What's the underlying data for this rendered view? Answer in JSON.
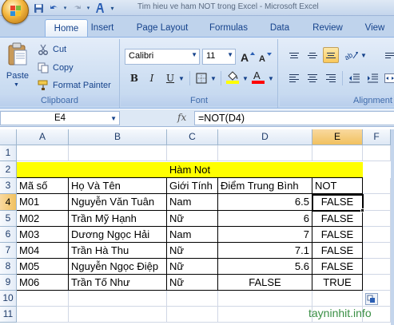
{
  "window": {
    "title": "Tim hieu ve ham NOT trong Excel - Microsoft Excel"
  },
  "tabs": [
    "Home",
    "Insert",
    "Page Layout",
    "Formulas",
    "Data",
    "Review",
    "View"
  ],
  "clipboard": {
    "paste_label": "Paste",
    "cut_label": "Cut",
    "copy_label": "Copy",
    "format_painter_label": "Format Painter",
    "group_label": "Clipboard"
  },
  "font": {
    "name": "Calibri",
    "size": "11",
    "group_label": "Font",
    "fill_color": "#ffff00",
    "font_color": "#ff0000"
  },
  "alignment": {
    "group_label": "Alignment"
  },
  "formula_bar": {
    "name_box": "E4",
    "fx": "fx",
    "formula": "=NOT(D4)"
  },
  "columns": [
    "A",
    "B",
    "C",
    "D",
    "E",
    "F"
  ],
  "rows": [
    "1",
    "2",
    "3",
    "4",
    "5",
    "6",
    "7",
    "8",
    "9",
    "10",
    "11"
  ],
  "sheet": {
    "title": "Hàm Not",
    "headers": [
      "Mã số",
      "Họ Và Tên",
      "Giới Tính",
      "Điểm Trung Bình",
      "NOT"
    ],
    "data": [
      [
        "M01",
        "Nguyễn Văn Tuân",
        "Nam",
        "6.5",
        "FALSE"
      ],
      [
        "M02",
        "Trần Mỹ Hạnh",
        "Nữ",
        "6",
        "FALSE"
      ],
      [
        "M03",
        "Dương Ngọc Hải",
        "Nam",
        "7",
        "FALSE"
      ],
      [
        "M04",
        "Trần Hà Thu",
        "Nữ",
        "7.1",
        "FALSE"
      ],
      [
        "M05",
        "Nguyễn Ngọc Điệp",
        "Nữ",
        "5.6",
        "FALSE"
      ],
      [
        "M06",
        "Trần Tố Như",
        "Nữ",
        "FALSE",
        "TRUE"
      ]
    ]
  },
  "watermark": "tayninhit.info"
}
